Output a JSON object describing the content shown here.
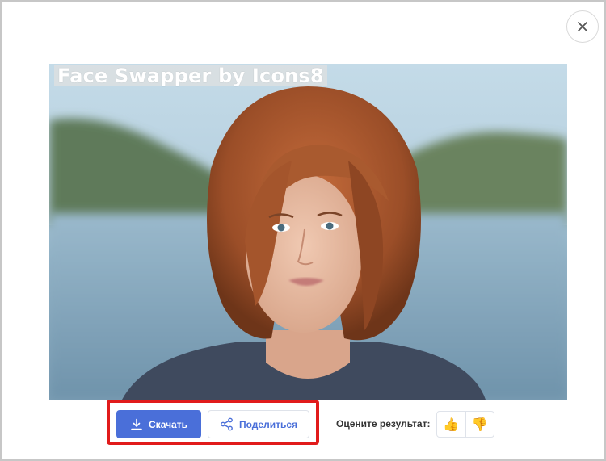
{
  "watermark": {
    "text": "Face Swapper by Icons8"
  },
  "actions": {
    "download_label": "Скачать",
    "share_label": "Поделиться"
  },
  "rating": {
    "label": "Оцените результат:",
    "like_glyph": "👍",
    "dislike_glyph": "👎"
  },
  "icons": {
    "close": "close-icon",
    "download": "download-icon",
    "share": "share-icon"
  },
  "colors": {
    "accent": "#4a6fd9",
    "highlight": "#e11b1b"
  }
}
